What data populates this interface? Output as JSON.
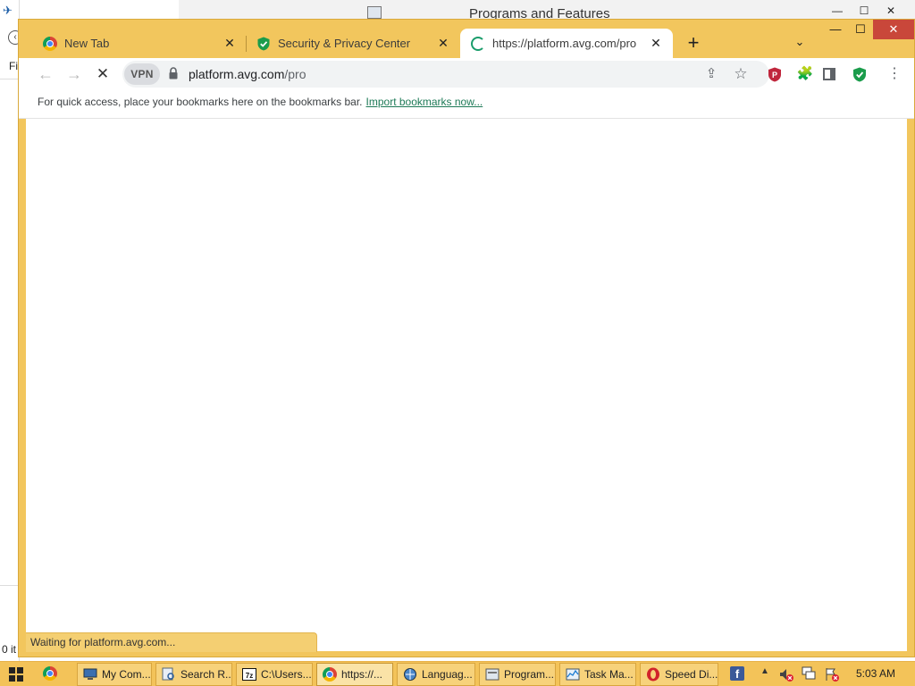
{
  "background_window": {
    "title": "Programs and Features",
    "controls": {
      "min": "—",
      "max": "☐",
      "close": "✕"
    },
    "left_text": "Fi",
    "status_text": "0 it"
  },
  "chrome": {
    "window_controls": {
      "min": "—",
      "max": "☐",
      "close": "✕"
    },
    "tabs": [
      {
        "title": "New Tab",
        "icon": "chrome-icon",
        "close": "✕"
      },
      {
        "title": "Security & Privacy Center",
        "icon": "shield-check-icon",
        "close": "✕"
      },
      {
        "title": "https://platform.avg.com/pro",
        "icon": "loading-spinner-icon",
        "close": "✕",
        "active": true
      }
    ],
    "new_tab": "+",
    "tab_search": "⌄",
    "toolbar": {
      "back": "←",
      "forward": "→",
      "stop": "✕",
      "vpn": "VPN",
      "url_host": "platform.avg.com",
      "url_path": "/pro",
      "share": "⇪",
      "bookmark_star": "☆",
      "extensions": "🧩",
      "menu": "⋮"
    },
    "bookmarks_bar": {
      "text": "For quick access, place your bookmarks here on the bookmarks bar.",
      "link": "Import bookmarks now..."
    },
    "status_bubble": "Waiting for platform.avg.com...",
    "colors": {
      "frame": "#f2c65d",
      "accent": "#1a9c6b",
      "close_red": "#c9473a"
    }
  },
  "taskbar": {
    "tasks": [
      {
        "label": "My Com...",
        "icon": "computer-icon"
      },
      {
        "label": "Search R...",
        "icon": "search-results-icon"
      },
      {
        "label": "C:\\Users...",
        "icon": "7zip-icon"
      },
      {
        "label": "https://...",
        "icon": "chrome-icon",
        "active": true
      },
      {
        "label": "Languag...",
        "icon": "language-icon"
      },
      {
        "label": "Program...",
        "icon": "programs-icon"
      },
      {
        "label": "Task Ma...",
        "icon": "task-manager-icon"
      },
      {
        "label": "Speed Di...",
        "icon": "opera-icon"
      }
    ],
    "tray_up": "▲",
    "clock": "5:03 AM"
  }
}
